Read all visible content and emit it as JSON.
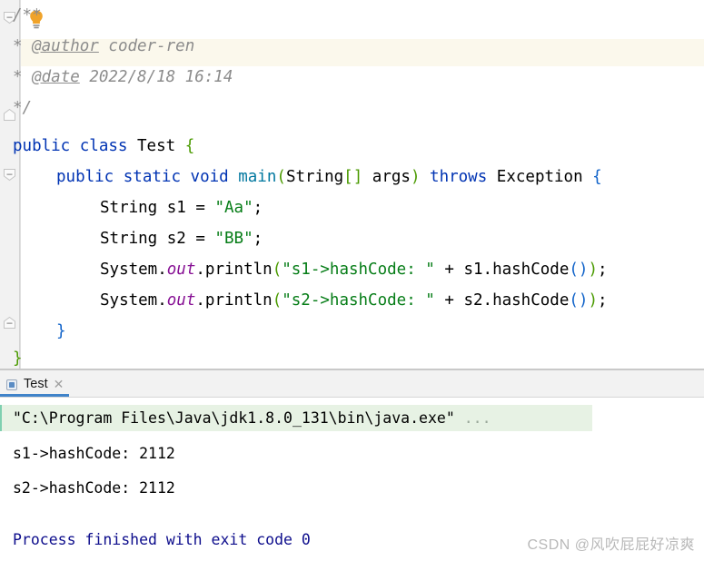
{
  "editor": {
    "language": "java",
    "caret_line_index": 1,
    "highlight_color": "#fbf8ec",
    "background": "#ffffff",
    "intention_icon": "lightbulb-icon",
    "gutter": {
      "background": "#f2f2f2",
      "fold_markers": [
        "collapse",
        "collapse",
        "collapse",
        "expand-end",
        "expand-end"
      ]
    },
    "lines": [
      {
        "indent": 0,
        "text": "/**"
      },
      {
        "indent": 0,
        "text": " * @author coder-ren"
      },
      {
        "indent": 0,
        "text": " * @date 2022/8/18 16:14"
      },
      {
        "indent": 0,
        "text": " */"
      },
      {
        "indent": 0,
        "text": "public class Test {"
      },
      {
        "indent": 1,
        "text": "public static void main(String[] args) throws Exception {"
      },
      {
        "indent": 2,
        "text": "String s1 = \"Aa\";"
      },
      {
        "indent": 2,
        "text": "String s2 = \"BB\";"
      },
      {
        "indent": 2,
        "text": "System.out.println(\"s1->hashCode: \" + s1.hashCode());"
      },
      {
        "indent": 2,
        "text": "System.out.println(\"s2->hashCode: \" + s2.hashCode());"
      },
      {
        "indent": 1,
        "text": "}"
      },
      {
        "indent": 0,
        "text": "}"
      }
    ],
    "tokens": {
      "comment_open": "/**",
      "comment_star": "*",
      "author_tag": "@author",
      "author_value": "coder-ren",
      "date_tag": "@date",
      "date_value": "2022/8/18 16:14",
      "comment_close": "*/",
      "kw_public": "public",
      "kw_class": "class",
      "class_name": "Test",
      "kw_static": "static",
      "kw_void": "void",
      "method_main": "main",
      "type_string": "String",
      "brackets_empty": "[]",
      "param_args": "args",
      "kw_throws": "throws",
      "type_exception": "Exception",
      "var_s1": "s1",
      "var_s2": "s2",
      "assign": "=",
      "literal_aa": "\"Aa\"",
      "literal_bb": "\"BB\"",
      "semicolon": ";",
      "sys": "System",
      "out": "out",
      "println": "println",
      "msg_s1": "\"s1->hashCode: \"",
      "msg_s2": "\"s2->hashCode: \"",
      "plus": "+",
      "hashcode_call": "hashCode()",
      "brace_open": "{",
      "brace_close": "}",
      "paren_open": "(",
      "paren_close": ")",
      "dot": "."
    },
    "colors": {
      "keyword": "#0033b3",
      "comment": "#8c8c8c",
      "string": "#067d17",
      "method": "#00779f",
      "static_field": "#871094",
      "bracket_outer": "#4a9a00",
      "bracket_inner": "#0f62c9",
      "text": "#000000"
    }
  },
  "console": {
    "tab": {
      "label": "Test",
      "icon": "run-configuration-icon",
      "close_icon": "close-icon",
      "active": true,
      "underline_color": "#4083c9"
    },
    "command_line": "\"C:\\Program Files\\Java\\jdk1.8.0_131\\bin\\java.exe\"",
    "command_ellipsis": "...",
    "command_highlight_color": "#e7f2e4",
    "output": [
      "s1->hashCode: 2112",
      "s2->hashCode: 2112"
    ],
    "exit_message": "Process finished with exit code 0",
    "exit_color": "#0d0d8c"
  },
  "watermark": {
    "text": "CSDN @风吹屁屁好凉爽",
    "color": "#b9b9b9"
  }
}
